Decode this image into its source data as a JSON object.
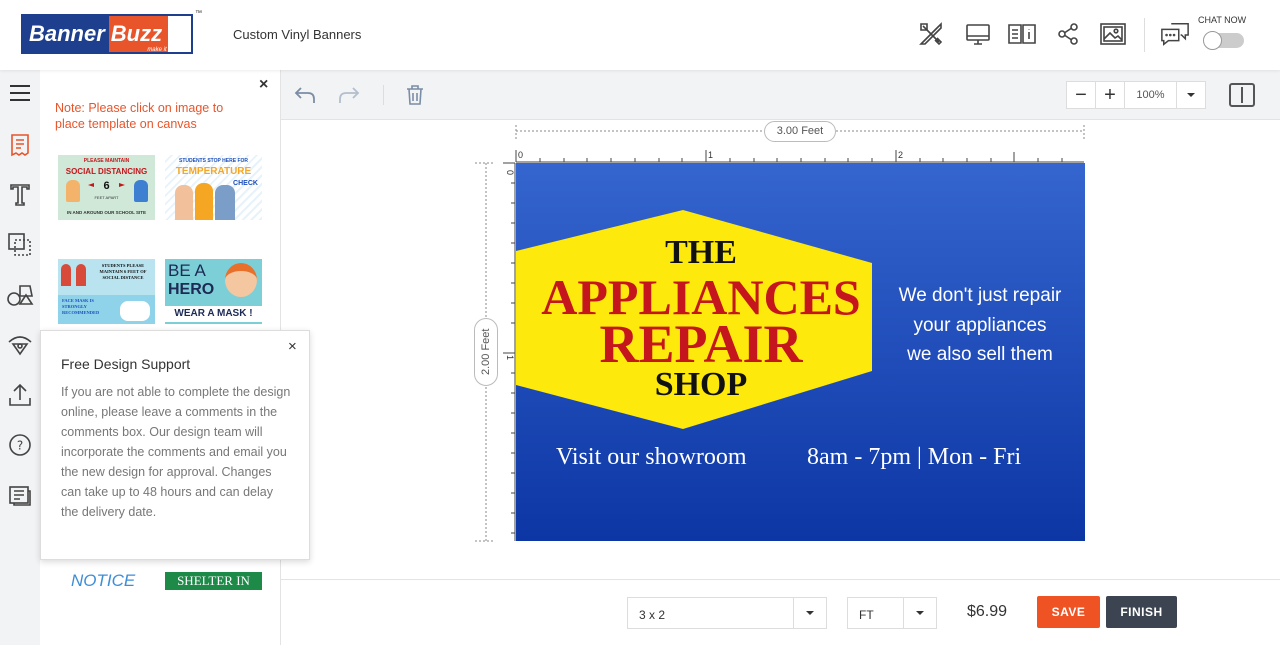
{
  "header": {
    "logo_part1": "Banner",
    "logo_part2": "Buzz",
    "logo_tagline": "make it visible",
    "logo_tm": "™",
    "product_name": "Custom Vinyl Banners",
    "chat_label": "CHAT NOW",
    "icons": [
      "design-tools-icon",
      "preview-monitor-icon",
      "spec-book-icon",
      "share-icon",
      "image-gallery-icon",
      "chat-icon"
    ]
  },
  "left_rail": {
    "icons": [
      "menu-icon",
      "templates-icon",
      "text-icon",
      "layers-icon",
      "shapes-icon",
      "clipart-icon",
      "upload-icon",
      "help-icon",
      "comments-icon"
    ],
    "accent_color": "#e8552b"
  },
  "template_panel": {
    "close": "×",
    "note": "Note: Please click on image to place template on canvas",
    "thumbs": [
      {
        "l1": "PLEASE MAINTAIN",
        "l2": "SOCIAL DISTANCING",
        "l3": "6",
        "l4": "FEET APART",
        "l5": "IN AND AROUND OUR SCHOOL SITE"
      },
      {
        "l1": "STUDENTS STOP HERE FOR",
        "l2": "TEMPERATURE",
        "l3": "CHECK"
      },
      {
        "l1": "STUDENTS PLEASE MAINTAIN 6 FEET OF SOCIAL DISTANCE",
        "l2": "FACE MASK IS STRONGLY RECOMMENDED"
      },
      {
        "l1": "BE A",
        "l2": "HERO",
        "l3": "WEAR A MASK !"
      }
    ],
    "bottom_thumbs": [
      "NOTICE",
      "SHELTER IN PLACE"
    ]
  },
  "support_popup": {
    "title": "Free Design Support",
    "close": "×",
    "body": "If you are not able to complete the design online, please leave a comments in the comments box. Our design team will incorporate the comments and email you the new design for approval. Changes can take up to 48 hours and can delay the delivery date."
  },
  "toolbar": {
    "zoom_minus": "−",
    "zoom_plus": "+",
    "zoom_value": "100%"
  },
  "canvas": {
    "width_label": "3.00 Feet",
    "height_label": "2.00 Feet",
    "ruler_top": [
      "0",
      "1",
      "2"
    ],
    "ruler_left": [
      "0",
      "1"
    ]
  },
  "banner": {
    "line_the": "THE",
    "line_appliances": "APPLIANCES",
    "line_repair": "REPAIR",
    "line_shop": "SHOP",
    "tag1": "We don't just repair",
    "tag2": "your appliances",
    "tag3": "we also sell them",
    "visit": "Visit our showroom",
    "hours": "8am - 7pm | Mon - Fri",
    "colors": {
      "bg_top": "#3565cf",
      "bg_bottom": "#0c36a4",
      "hex_fill": "#fde90b",
      "title_red": "#c4161c"
    }
  },
  "footer": {
    "size_value": "3 x 2",
    "unit_value": "FT",
    "price": "$6.99",
    "save_label": "SAVE",
    "finish_label": "FINISH",
    "save_color": "#f05323",
    "finish_color": "#3b4450"
  }
}
